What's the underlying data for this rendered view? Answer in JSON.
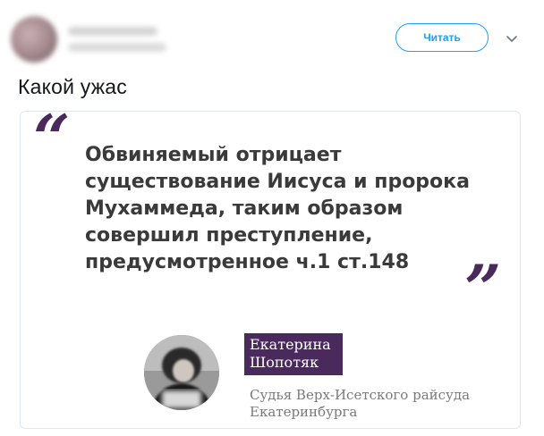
{
  "header": {
    "follow_label": "Читать",
    "chevron_icon": "chevron-down-icon"
  },
  "tweet": {
    "text": "Какой ужас"
  },
  "media": {
    "open_quote": "“",
    "close_quote": "”",
    "quote_text": "Обвиняемый отрицает\nсуществование Иисуса и пророка\nМухаммеда, таким образом\nсовершил преступление,\nпредусмотренное ч.1 ст.148",
    "person": {
      "first_name": "Екатерина",
      "last_name": "Шопотяк",
      "caption_line1": "Судья Верх-Исетского райсуда",
      "caption_line2": "Екатеринбурга"
    },
    "accent_color": "#4a2a5c"
  },
  "colors": {
    "brand": "#1da1f2",
    "text": "#14171a",
    "quote_text": "#3a3a3a",
    "caption": "#7a7a7a"
  }
}
